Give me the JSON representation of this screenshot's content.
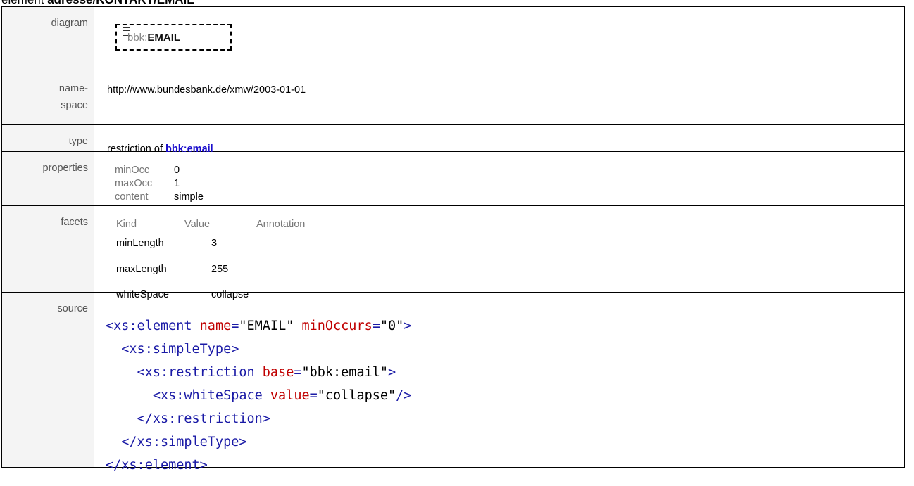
{
  "header": {
    "prefix": "element ",
    "path": "adresse/KONTAKT/EMAIL"
  },
  "labels": {
    "diagram": "diagram",
    "namespace_line1": "name-",
    "namespace_line2": "space",
    "type": "type",
    "properties": "properties",
    "facets": "facets",
    "source": "source"
  },
  "diagram": {
    "prefix": "bbk:",
    "name": "EMAIL",
    "icon": "sequence-icon"
  },
  "namespace": "http://www.bundesbank.de/xmw/2003-01-01",
  "type": {
    "text": "restriction of ",
    "link": "bbk:email"
  },
  "properties": [
    {
      "key": "minOcc",
      "value": "0"
    },
    {
      "key": "maxOcc",
      "value": "1"
    },
    {
      "key": "content",
      "value": "simple"
    }
  ],
  "facets": {
    "headers": [
      "Kind",
      "Value",
      "Annotation"
    ],
    "rows": [
      {
        "kind": "minLength",
        "value": "3"
      },
      {
        "kind": "maxLength",
        "value": "255"
      },
      {
        "kind": "whiteSpace",
        "value": "collapse"
      }
    ]
  },
  "source": {
    "lines": [
      {
        "indent": "",
        "open": "<xs:element",
        "attrs": [
          {
            "name": "name",
            "value": "\"EMAIL\""
          },
          {
            "name": "minOccurs",
            "value": "\"0\""
          }
        ],
        "close": ">"
      },
      {
        "indent": "  ",
        "open": "<xs:simpleType",
        "attrs": [],
        "close": ">"
      },
      {
        "indent": "    ",
        "open": "<xs:restriction",
        "attrs": [
          {
            "name": "base",
            "value": "\"bbk:email\""
          }
        ],
        "close": ">"
      },
      {
        "indent": "      ",
        "open": "<xs:whiteSpace",
        "attrs": [
          {
            "name": "value",
            "value": "\"collapse\""
          }
        ],
        "close": "/>"
      },
      {
        "indent": "    ",
        "open": "</xs:restriction",
        "attrs": [],
        "close": ">"
      },
      {
        "indent": "  ",
        "open": "</xs:simpleType",
        "attrs": [],
        "close": ">"
      },
      {
        "indent": "",
        "open": "</xs:element",
        "attrs": [],
        "close": ">"
      }
    ]
  }
}
